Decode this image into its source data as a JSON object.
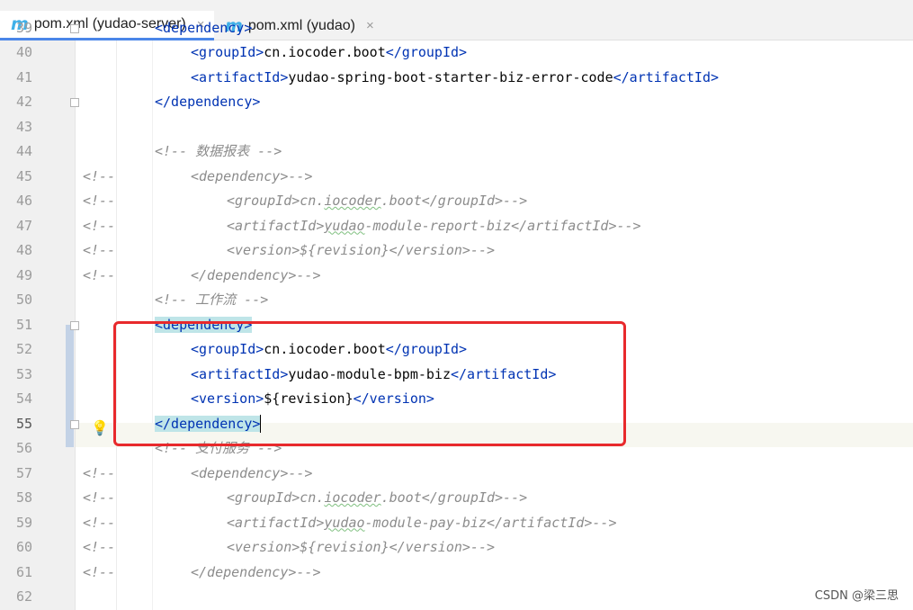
{
  "tabs": [
    {
      "icon": "maven-m-icon",
      "glyph": "m",
      "label": "pom.xml (yudao-server)",
      "active": true
    },
    {
      "icon": "maven-m-icon",
      "glyph": "m",
      "label": "pom.xml (yudao)",
      "active": false
    }
  ],
  "close_glyph": "×",
  "lines": [
    {
      "n": "39",
      "indent": 172,
      "parts": [
        [
          "tag",
          "<dependency>"
        ]
      ]
    },
    {
      "n": "40",
      "indent": 212,
      "parts": [
        [
          "tag",
          "<groupId>"
        ],
        [
          "ptx",
          "cn.iocoder.boot"
        ],
        [
          "tag",
          "</groupId>"
        ]
      ]
    },
    {
      "n": "41",
      "indent": 212,
      "parts": [
        [
          "tag",
          "<artifactId>"
        ],
        [
          "ptx",
          "yudao-spring-boot-starter-biz-error-code"
        ],
        [
          "tag",
          "</artifactId>"
        ]
      ]
    },
    {
      "n": "42",
      "indent": 172,
      "parts": [
        [
          "tag",
          "</dependency>"
        ]
      ]
    },
    {
      "n": "43",
      "indent": 172,
      "parts": []
    },
    {
      "n": "44",
      "indent": 172,
      "parts": [
        [
          "ctx",
          "<!-- 数据报表 -->"
        ]
      ]
    },
    {
      "n": "45",
      "cm": "<!--",
      "indent": 212,
      "parts": [
        [
          "ctx",
          "<dependency>-->"
        ]
      ]
    },
    {
      "n": "46",
      "cm": "<!--",
      "indent": 252,
      "parts": [
        [
          "ctx",
          "<groupId>cn."
        ],
        [
          "ctx ul",
          "iocoder"
        ],
        [
          "ctx",
          ".boot</groupId>-->"
        ]
      ]
    },
    {
      "n": "47",
      "cm": "<!--",
      "indent": 252,
      "parts": [
        [
          "ctx",
          "<artifactId>"
        ],
        [
          "ctx ul",
          "yudao"
        ],
        [
          "ctx",
          "-module-report-biz</artifactId>-->"
        ]
      ]
    },
    {
      "n": "48",
      "cm": "<!--",
      "indent": 252,
      "parts": [
        [
          "ctx",
          "<version>${revision}</version>-->"
        ]
      ]
    },
    {
      "n": "49",
      "cm": "<!--",
      "indent": 212,
      "parts": [
        [
          "ctx",
          "</dependency>-->"
        ]
      ]
    },
    {
      "n": "50",
      "indent": 172,
      "parts": [
        [
          "ctx",
          "<!-- 工作流 -->"
        ]
      ]
    },
    {
      "n": "51",
      "indent": 172,
      "parts": [
        [
          "tag hl",
          "<dependency>"
        ]
      ]
    },
    {
      "n": "52",
      "indent": 212,
      "parts": [
        [
          "tag",
          "<groupId>"
        ],
        [
          "ptx",
          "cn.iocoder.boot"
        ],
        [
          "tag",
          "</groupId>"
        ]
      ]
    },
    {
      "n": "53",
      "indent": 212,
      "parts": [
        [
          "tag",
          "<artifactId>"
        ],
        [
          "ptx",
          "yudao-module-bpm-biz"
        ],
        [
          "tag",
          "</artifactId>"
        ]
      ]
    },
    {
      "n": "54",
      "indent": 212,
      "parts": [
        [
          "tag",
          "<version>"
        ],
        [
          "ptx",
          "${revision}"
        ],
        [
          "tag",
          "</version>"
        ]
      ]
    },
    {
      "n": "55",
      "indent": 172,
      "parts": [
        [
          "tag hl2",
          "</dependency>"
        ]
      ],
      "current": true
    },
    {
      "n": "56",
      "indent": 172,
      "parts": [
        [
          "ctx",
          "<!-- 支付服务 -->"
        ]
      ]
    },
    {
      "n": "57",
      "cm": "<!--",
      "indent": 212,
      "parts": [
        [
          "ctx",
          "<dependency>-->"
        ]
      ]
    },
    {
      "n": "58",
      "cm": "<!--",
      "indent": 252,
      "parts": [
        [
          "ctx",
          "<groupId>cn."
        ],
        [
          "ctx ul",
          "iocoder"
        ],
        [
          "ctx",
          ".boot</groupId>-->"
        ]
      ]
    },
    {
      "n": "59",
      "cm": "<!--",
      "indent": 252,
      "parts": [
        [
          "ctx",
          "<artifactId>"
        ],
        [
          "ctx ul",
          "yudao"
        ],
        [
          "ctx",
          "-module-pay-biz</artifactId>-->"
        ]
      ]
    },
    {
      "n": "60",
      "cm": "<!--",
      "indent": 252,
      "parts": [
        [
          "ctx",
          "<version>${revision}</version>-->"
        ]
      ]
    },
    {
      "n": "61",
      "cm": "<!--",
      "indent": 212,
      "parts": [
        [
          "ctx",
          "</dependency>-->"
        ]
      ]
    },
    {
      "n": "62",
      "indent": 172,
      "parts": []
    }
  ],
  "colors": {
    "highlight_box": "#e8292c",
    "tag": "#0033b3",
    "comment": "#8c8c8c"
  },
  "intention_icon": "lightbulb-icon",
  "watermark": "CSDN @梁三思"
}
